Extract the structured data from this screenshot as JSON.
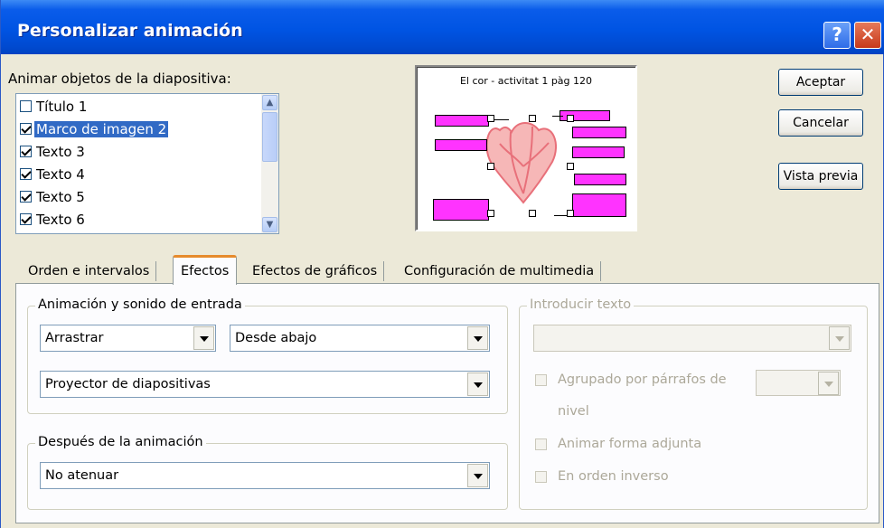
{
  "window": {
    "title": "Personalizar animación",
    "help_glyph": "?",
    "close_glyph": "✕"
  },
  "objects": {
    "label": "Animar objetos de la diapositiva:",
    "items": [
      {
        "label": "Título 1",
        "checked": false,
        "selected": false
      },
      {
        "label": "Marco de imagen 2",
        "checked": true,
        "selected": true
      },
      {
        "label": "Texto 3",
        "checked": true,
        "selected": false
      },
      {
        "label": "Texto 4",
        "checked": true,
        "selected": false
      },
      {
        "label": "Texto 5",
        "checked": true,
        "selected": false
      },
      {
        "label": "Texto 6",
        "checked": true,
        "selected": false
      }
    ],
    "scroll_up_glyph": "▲",
    "scroll_down_glyph": "▼"
  },
  "preview": {
    "title": "El cor - activitat 1 pàg 120"
  },
  "buttons": {
    "accept": "Aceptar",
    "cancel": "Cancelar",
    "preview": "Vista previa"
  },
  "tabs": [
    {
      "label": "Orden e intervalos",
      "active": false
    },
    {
      "label": "Efectos",
      "active": true
    },
    {
      "label": "Efectos de gráficos",
      "active": false
    },
    {
      "label": "Configuración de multimedia",
      "active": false
    }
  ],
  "effects": {
    "entry_group": "Animación y sonido de entrada",
    "effect_value": "Arrastrar",
    "direction_value": "Desde abajo",
    "sound_value": "Proyector de diapositivas",
    "after_group": "Después de la animación",
    "after_value": "No atenuar"
  },
  "text_intro": {
    "group": "Introducir texto",
    "combo_value": "",
    "grouped_label": "Agrupado por párrafos de",
    "grouped_label_line2": "nivel",
    "level_value": "",
    "animate_shape_label": "Animar forma adjunta",
    "reverse_order_label": "En orden inverso"
  }
}
